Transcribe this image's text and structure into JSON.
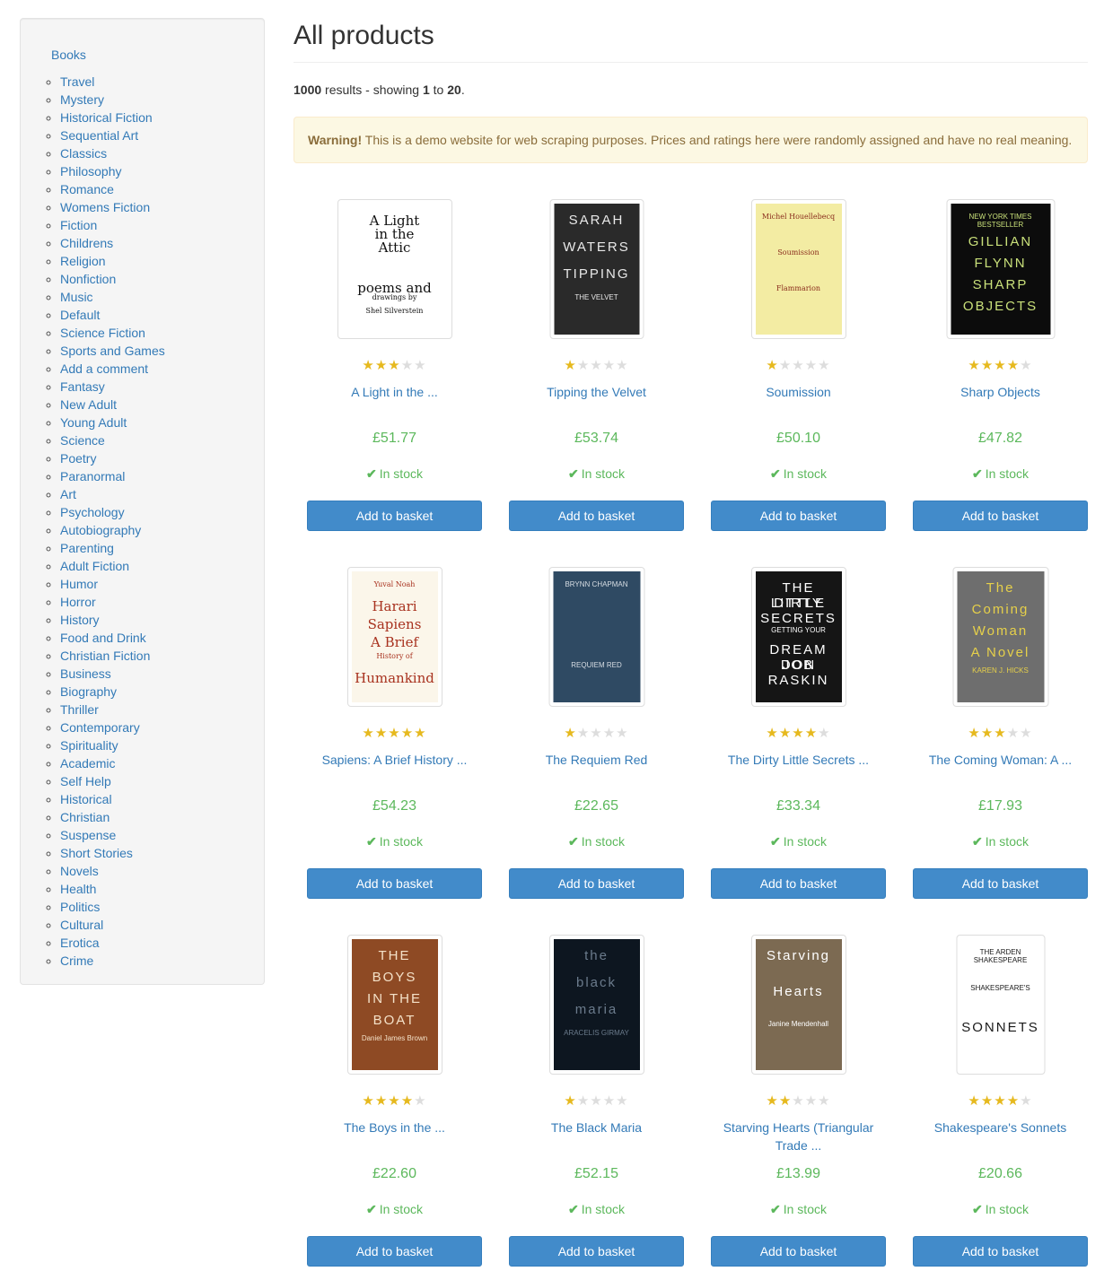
{
  "sidebar": {
    "top_link": "Books",
    "categories": [
      "Travel",
      "Mystery",
      "Historical Fiction",
      "Sequential Art",
      "Classics",
      "Philosophy",
      "Romance",
      "Womens Fiction",
      "Fiction",
      "Childrens",
      "Religion",
      "Nonfiction",
      "Music",
      "Default",
      "Science Fiction",
      "Sports and Games",
      "Add a comment",
      "Fantasy",
      "New Adult",
      "Young Adult",
      "Science",
      "Poetry",
      "Paranormal",
      "Art",
      "Psychology",
      "Autobiography",
      "Parenting",
      "Adult Fiction",
      "Humor",
      "Horror",
      "History",
      "Food and Drink",
      "Christian Fiction",
      "Business",
      "Biography",
      "Thriller",
      "Contemporary",
      "Spirituality",
      "Academic",
      "Self Help",
      "Historical",
      "Christian",
      "Suspense",
      "Short Stories",
      "Novels",
      "Health",
      "Politics",
      "Cultural",
      "Erotica",
      "Crime"
    ]
  },
  "main": {
    "title": "All products",
    "results": {
      "total": "1000",
      "text_mid": " results - showing ",
      "from": "1",
      "to_text": " to ",
      "to": "20",
      "end": "."
    },
    "alert": {
      "strong": "Warning!",
      "text": " This is a demo website for web scraping purposes. Prices and ratings here were randomly assigned and have no real meaning."
    }
  },
  "products": [
    {
      "title": "A Light in the ...",
      "price": "£51.77",
      "rating": 3,
      "stock": "In stock",
      "button": "Add to basket",
      "cover": {
        "bg": "#ffffff",
        "fg": "#111111",
        "lines": [
          "A Light",
          "in the",
          "Attic",
          "",
          "",
          "poems and",
          "drawings by",
          "Shel Silverstein"
        ]
      }
    },
    {
      "title": "Tipping the Velvet",
      "price": "£53.74",
      "rating": 1,
      "stock": "In stock",
      "button": "Add to basket",
      "cover": {
        "bg": "#2a2a2a",
        "fg": "#e8e8e8",
        "lines": [
          "SARAH",
          "WATERS",
          "TIPPING",
          "THE VELVET"
        ]
      }
    },
    {
      "title": "Soumission",
      "price": "£50.10",
      "rating": 1,
      "stock": "In stock",
      "button": "Add to basket",
      "cover": {
        "bg": "#f3eca3",
        "fg": "#8a2d1d",
        "lines": [
          "Michel Houellebecq",
          "Soumission",
          "Flammarion"
        ]
      }
    },
    {
      "title": "Sharp Objects",
      "price": "£47.82",
      "rating": 4,
      "stock": "In stock",
      "button": "Add to basket",
      "cover": {
        "bg": "#0c0c0c",
        "fg": "#c9e07a",
        "lines": [
          "NEW YORK TIMES BESTSELLER",
          "GILLIAN",
          "FLYNN",
          "SHARP",
          "OBJECTS"
        ]
      }
    },
    {
      "title": "Sapiens: A Brief History ...",
      "price": "£54.23",
      "rating": 5,
      "stock": "In stock",
      "button": "Add to basket",
      "cover": {
        "bg": "#fbf6ea",
        "fg": "#a8321f",
        "lines": [
          "Yuval Noah",
          "Harari",
          "Sapiens",
          "A Brief",
          "History of",
          "Humankind"
        ]
      }
    },
    {
      "title": "The Requiem Red",
      "price": "£22.65",
      "rating": 1,
      "stock": "In stock",
      "button": "Add to basket",
      "cover": {
        "bg": "#2f4a63",
        "fg": "#d7dde3",
        "lines": [
          "BRYNN CHAPMAN",
          "",
          "",
          "REQUIEM RED"
        ]
      }
    },
    {
      "title": "The Dirty Little Secrets ...",
      "price": "£33.34",
      "rating": 4,
      "stock": "In stock",
      "button": "Add to basket",
      "cover": {
        "bg": "#151515",
        "fg": "#ffffff",
        "lines": [
          "THE DIRTY",
          "LITTLE",
          "SECRETS",
          "GETTING YOUR",
          "DREAM JOB",
          "DON",
          "RASKIN"
        ]
      }
    },
    {
      "title": "The Coming Woman: A ...",
      "price": "£17.93",
      "rating": 3,
      "stock": "In stock",
      "button": "Add to basket",
      "cover": {
        "bg": "#6e6e6e",
        "fg": "#e6d04a",
        "lines": [
          "The",
          "Coming",
          "Woman",
          "A Novel",
          "KAREN J. HICKS"
        ]
      }
    },
    {
      "title": "The Boys in the ...",
      "price": "£22.60",
      "rating": 4,
      "stock": "In stock",
      "button": "Add to basket",
      "cover": {
        "bg": "#8e4a24",
        "fg": "#f4e1c8",
        "lines": [
          "THE",
          "BOYS",
          "IN THE",
          "BOAT",
          "Daniel James Brown"
        ]
      }
    },
    {
      "title": "The Black Maria",
      "price": "£52.15",
      "rating": 1,
      "stock": "In stock",
      "button": "Add to basket",
      "cover": {
        "bg": "#0d1620",
        "fg": "#6b7b8c",
        "lines": [
          "the",
          "black",
          "maria",
          "ARACELIS GIRMAY"
        ]
      }
    },
    {
      "title": "Starving Hearts (Triangular Trade ...",
      "price": "£13.99",
      "rating": 2,
      "stock": "In stock",
      "button": "Add to basket",
      "cover": {
        "bg": "#7c6a52",
        "fg": "#ffffff",
        "lines": [
          "Starving",
          "Hearts",
          "Janine Mendenhall"
        ]
      }
    },
    {
      "title": "Shakespeare's Sonnets",
      "price": "£20.66",
      "rating": 4,
      "stock": "In stock",
      "button": "Add to basket",
      "cover": {
        "bg": "#ffffff",
        "fg": "#1a1a1a",
        "lines": [
          "THE ARDEN SHAKESPEARE",
          "SHAKESPEARE'S",
          "SONNETS"
        ]
      }
    }
  ],
  "colors": {
    "link": "#337ab7",
    "price": "#5cb85c",
    "button": "#428bca",
    "star_on": "#e6b91e",
    "star_off": "#dddddd",
    "alert_bg": "#fcf8e3",
    "alert_text": "#8a6d3b"
  },
  "icons": {
    "star": "star-icon",
    "check": "check-icon"
  }
}
